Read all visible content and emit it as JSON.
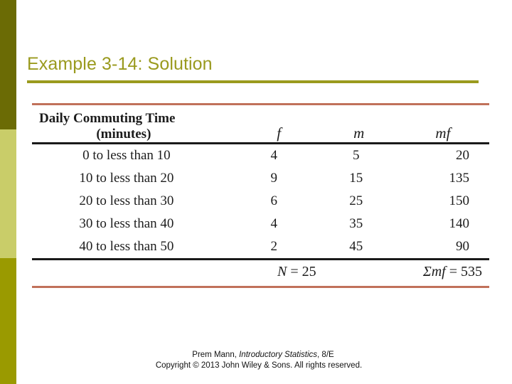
{
  "slide": {
    "title": "Example 3-14: Solution",
    "title_color": "#9a9a1e",
    "accent_rule_color": "#c1715a",
    "sidebar": {
      "top_color": "#6b6b05",
      "middle_color": "#c9cd69",
      "bottom_color": "#9a9a00"
    }
  },
  "table": {
    "headers": {
      "class_line1": "Daily Commuting Time",
      "class_line2": "(minutes)",
      "f": "f",
      "m": "m",
      "mf": "mf"
    },
    "rows": [
      {
        "klass": "0 to less than 10",
        "f": "4",
        "m": "5",
        "mf": "20"
      },
      {
        "klass": "10 to less than 20",
        "f": "9",
        "m": "15",
        "mf": "135"
      },
      {
        "klass": "20 to less than 30",
        "f": "6",
        "m": "25",
        "mf": "150"
      },
      {
        "klass": "30 to less than 40",
        "f": "4",
        "m": "35",
        "mf": "140"
      },
      {
        "klass": "40 to less than 50",
        "f": "2",
        "m": "45",
        "mf": "90"
      }
    ],
    "totals": {
      "n_label": "N",
      "n_equals": " = ",
      "n_value": "25",
      "sum_label": "Σmf",
      "sum_equals": " = ",
      "sum_value": "535"
    }
  },
  "footer": {
    "line1_author": "Prem Mann, ",
    "line1_book": "Introductory Statistics",
    "line1_edition": ", 8/E",
    "line2": "Copyright © 2013 John Wiley & Sons. All rights reserved."
  }
}
